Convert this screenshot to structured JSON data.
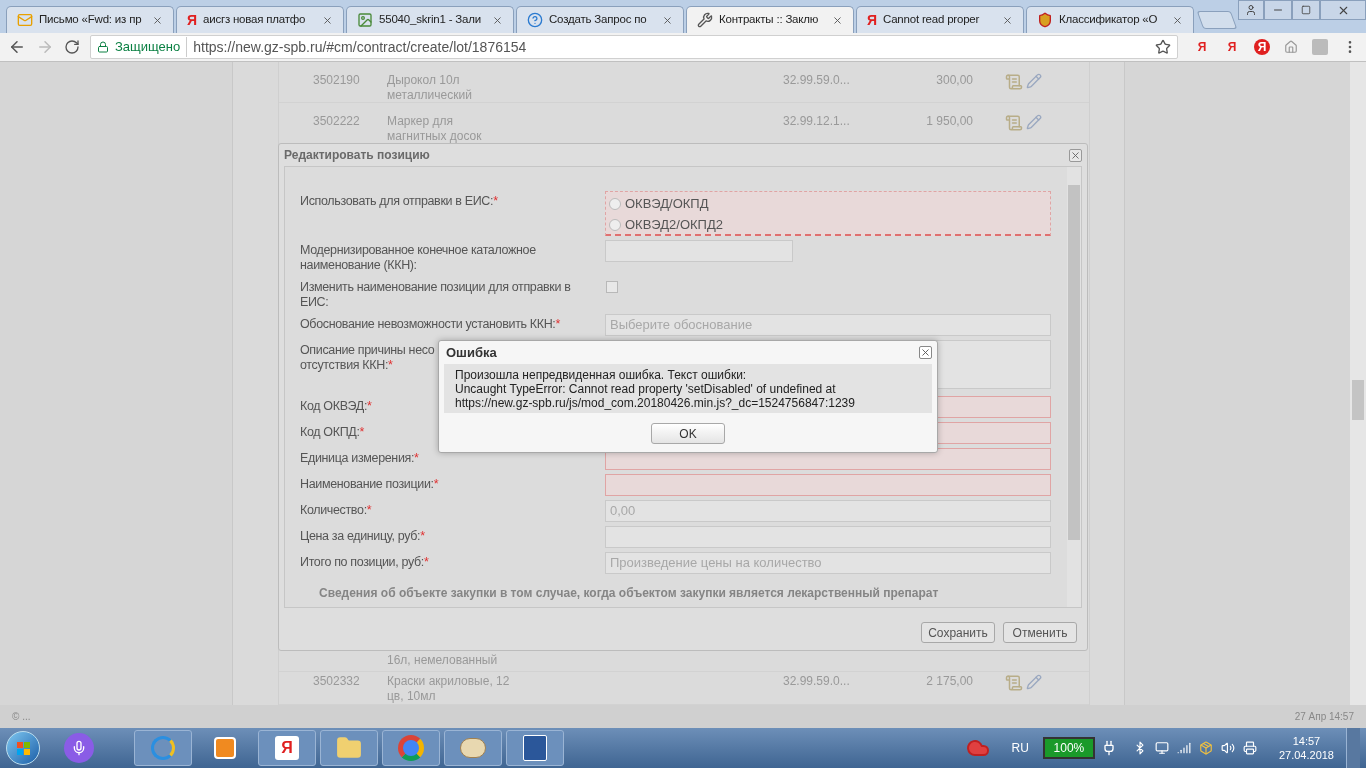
{
  "browser": {
    "tabs": [
      {
        "title": "Письмо «Fwd: из пр",
        "kind": "mail",
        "selected": false
      },
      {
        "title": "аисгз новая платфо",
        "kind": "yandex",
        "icon_letter": "Я",
        "selected": false
      },
      {
        "title": "55040_skrin1 - Зали",
        "kind": "image",
        "selected": false
      },
      {
        "title": "Создать Запрос по",
        "kind": "help",
        "selected": false
      },
      {
        "title": "Контракты :: Заклю",
        "kind": "tools",
        "selected": true
      },
      {
        "title": "Cannot read proper",
        "kind": "yandex",
        "icon_letter": "Я",
        "selected": false
      },
      {
        "title": "Классификатор «О",
        "kind": "emblem",
        "selected": false
      }
    ],
    "security_label": "Защищено",
    "url": "https://new.gz-spb.ru/#cm/contract/create/lot/1876154",
    "extensions": [
      "Я",
      "Я",
      "Я"
    ]
  },
  "page": {
    "rows_top": [
      {
        "id": "3502190",
        "name_lines": [
          "Дырокол 10л",
          "металлический"
        ],
        "code": "32.99.59.0...",
        "price": "300,00"
      },
      {
        "id": "3502222",
        "name_lines": [
          "Маркер для",
          "магнитных досок"
        ],
        "code": "32.99.12.1...",
        "price": "1 950,00"
      }
    ],
    "rows_bottom": [
      {
        "name_lines": [
          "16л, немелованный"
        ]
      },
      {
        "id": "3502332",
        "name_lines": [
          "Краски акриловые, 12",
          "цв, 10мл"
        ],
        "code": "32.99.59.0...",
        "price": "2 175,00"
      }
    ]
  },
  "edit_dialog": {
    "title": "Редактировать позицию",
    "fields": [
      {
        "kind": "radio",
        "label_lines": [
          "Использовать для отправки в ЕИС:"
        ],
        "required_mark": "*",
        "invalid": true,
        "options": [
          {
            "label": "ОКВЭД/ОКПД",
            "selected": false
          },
          {
            "label": "ОКВЭД2/ОКПД2",
            "selected": false
          }
        ]
      },
      {
        "kind": "short_text",
        "label_lines": [
          "Модернизированное конечное каталожное",
          "наименование (ККН):"
        ],
        "invalid": false
      },
      {
        "kind": "checkbox",
        "label_lines": [
          "Изменить наименование позиции для отправки в",
          "ЕИС:"
        ],
        "checked": false
      },
      {
        "kind": "text",
        "label_lines": [
          "Обоснование невозможности установить ККН:"
        ],
        "required_mark": "*",
        "placeholder": "Выберите обоснование",
        "invalid": false
      },
      {
        "kind": "textarea",
        "label_lines": [
          "Описание причины несо",
          "отсутствия ККН:"
        ],
        "required_mark": "*",
        "invalid": false
      },
      {
        "kind": "text",
        "label_lines": [
          "Код ОКВЭД:"
        ],
        "required_mark": "*",
        "invalid": true
      },
      {
        "kind": "text",
        "label_lines": [
          "Код ОКПД:"
        ],
        "required_mark": "*",
        "invalid": true
      },
      {
        "kind": "text",
        "label_lines": [
          "Единица измерения:"
        ],
        "required_mark": "*",
        "invalid": true
      },
      {
        "kind": "text",
        "label_lines": [
          "Наименование позиции:"
        ],
        "required_mark": "*",
        "invalid": true
      },
      {
        "kind": "text",
        "label_lines": [
          "Количество:"
        ],
        "required_mark": "*",
        "placeholder": "0,00",
        "invalid": false
      },
      {
        "kind": "text",
        "label_lines": [
          "Цена за единицу, руб:"
        ],
        "required_mark": "*",
        "invalid": false
      },
      {
        "kind": "text",
        "label_lines": [
          "Итого по позиции, руб:"
        ],
        "required_mark": "*",
        "placeholder": "Произведение цены на количество",
        "invalid": false
      }
    ],
    "section_heading": "Сведения об объекте закупки в том случае, когда объектом закупки является лекарственный препарат",
    "buttons": [
      "Сохранить",
      "Отменить"
    ]
  },
  "error_dialog": {
    "title": "Ошибка",
    "message_lines": [
      "Произошла непредвиденная ошибка. Текст ошибки:",
      "Uncaught TypeError: Cannot read property 'setDisabled' of undefined at",
      "https://new.gz-spb.ru/js/mod_com.20180426.min.js?_dc=1524756847:1239"
    ],
    "button": "OK"
  },
  "status_bar": {
    "left": "© ...",
    "right": "27 Апр 14:57"
  },
  "taskbar": {
    "yandex_letter": "Я",
    "language": "RU",
    "battery": "100%",
    "time": "14:57",
    "date": "27.04.2018"
  }
}
